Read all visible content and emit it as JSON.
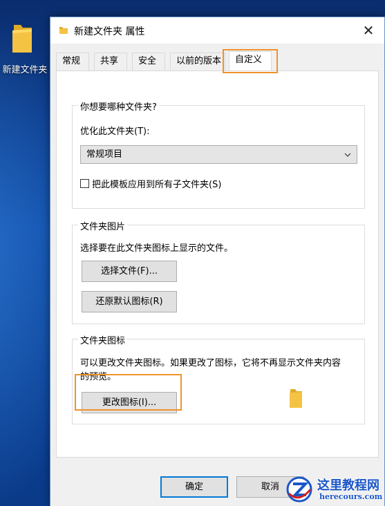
{
  "desktop": {
    "icon_label": "新建文件夹"
  },
  "window": {
    "title": "新建文件夹 属性",
    "close_glyph": "✕"
  },
  "tabs": [
    {
      "label": "常规"
    },
    {
      "label": "共享"
    },
    {
      "label": "安全"
    },
    {
      "label": "以前的版本"
    },
    {
      "label": "自定义"
    }
  ],
  "active_tab": "自定义",
  "folder_type": {
    "group_title": "你想要哪种文件夹?",
    "optimize_label": "优化此文件夹(T):",
    "selected_option": "常规项目",
    "apply_checkbox_label": "把此模板应用到所有子文件夹(S)",
    "apply_checked": false
  },
  "folder_pictures": {
    "group_title": "文件夹图片",
    "description": "选择要在此文件夹图标上显示的文件。",
    "choose_file_button": "选择文件(F)...",
    "restore_default_button": "还原默认图标(R)"
  },
  "folder_icons": {
    "group_title": "文件夹图标",
    "description_line1": "可以更改文件夹图标。如果更改了图标，它将不再显示文件夹内容",
    "description_line2": "的预览。",
    "change_icon_button": "更改图标(I)..."
  },
  "footer": {
    "ok_button": "确定",
    "cancel_button": "取消"
  },
  "watermark": {
    "title": "这里教程网",
    "url": "herecours.com"
  },
  "colors": {
    "highlight": "#f0922b",
    "accent": "#0078d7",
    "folder": "#f5c344"
  }
}
